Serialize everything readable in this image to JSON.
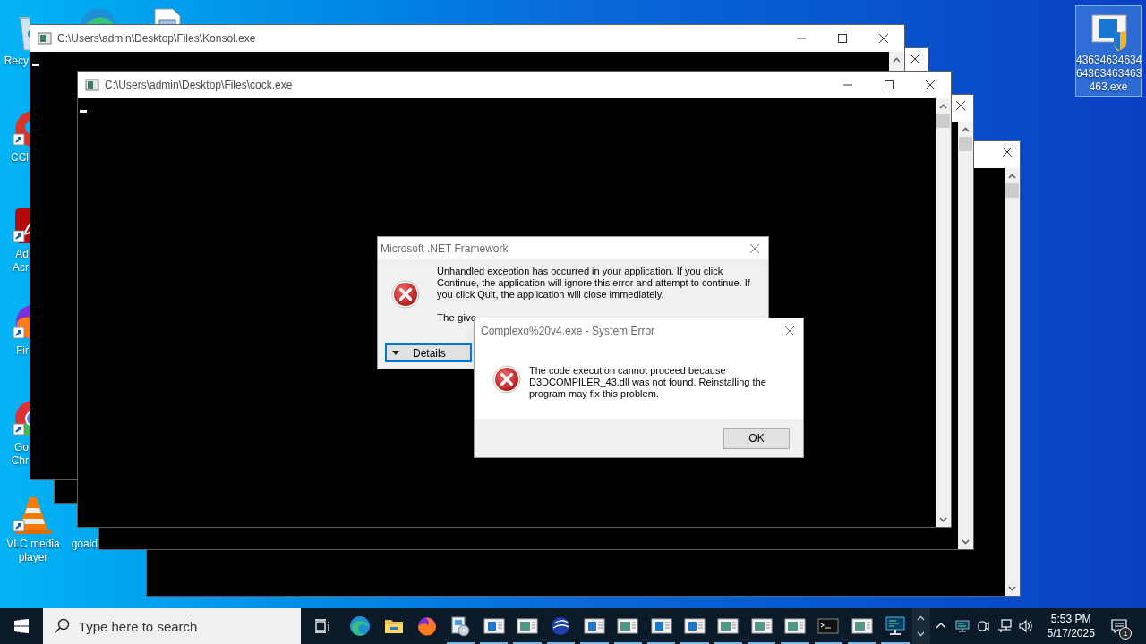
{
  "desktop": {
    "icons": [
      {
        "kind": "bin",
        "label": "Recy",
        "selected": false
      },
      {
        "kind": "edge",
        "selected": false
      },
      {
        "kind": "document",
        "selected": false
      },
      {
        "kind": "cleaner",
        "label": "CCl",
        "shortcut": true,
        "selected": false
      },
      {
        "kind": "pdf",
        "label": "Ad\nAcr",
        "shortcut": true,
        "selected": false
      },
      {
        "kind": "firefox",
        "label": "Fir",
        "shortcut": true,
        "selected": false
      },
      {
        "kind": "chrome",
        "label": "Go\nChr",
        "shortcut": true,
        "selected": false
      },
      {
        "kind": "vlc",
        "label": "VLC media\nplayer",
        "shortcut": true,
        "selected": false
      },
      {
        "kind": "blank",
        "label": "goald",
        "selected": false
      },
      {
        "kind": "installer",
        "label": "43634634634\n64363463463\n463.exe",
        "selected": true
      }
    ]
  },
  "console_windows": [
    {
      "kind": "untitled",
      "scrollbar": true
    },
    {
      "kind": "untitled",
      "scrollbar": true
    },
    {
      "kind": "untitled"
    },
    {
      "kind": "titled",
      "title": "C:\\Users\\admin\\Desktop\\Files\\Konsol.exe",
      "scrollbar": true,
      "cursor": true
    },
    {
      "kind": "titled",
      "title": "C:\\Users\\admin\\Desktop\\Files\\cock.exe",
      "scrollbar": true,
      "cursor": true
    }
  ],
  "net_dialog": {
    "title": "Microsoft .NET Framework",
    "message": "Unhandled exception has occurred in your application. If you click Continue, the application will ignore this error and attempt to continue. If you click Quit, the application will close immediately.",
    "detail": "The give",
    "details_button": "Details"
  },
  "system_error": {
    "title": "Complexo%20v4.exe - System Error",
    "message": "The code execution cannot proceed because D3DCOMPILER_43.dll was not found. Reinstalling the program may fix this problem.",
    "ok_button": "OK"
  },
  "taskbar": {
    "search": {
      "placeholder": "Type here to search"
    },
    "apps": [
      {
        "kind": "edge",
        "running": false
      },
      {
        "kind": "folder",
        "running": false
      },
      {
        "kind": "firefox",
        "running": false
      },
      {
        "kind": "installer",
        "running": true
      },
      {
        "kind": "window",
        "running": true
      },
      {
        "kind": "form",
        "running": true
      },
      {
        "kind": "badge",
        "running": true
      },
      {
        "kind": "window",
        "running": true
      },
      {
        "kind": "form",
        "running": true
      },
      {
        "kind": "window",
        "running": true
      },
      {
        "kind": "window",
        "running": true
      },
      {
        "kind": "form",
        "running": true
      },
      {
        "kind": "form",
        "running": true
      },
      {
        "kind": "form",
        "running": true
      },
      {
        "kind": "terminal",
        "running": true
      },
      {
        "kind": "form",
        "running": true
      },
      {
        "kind": "monitor",
        "running": true
      }
    ],
    "tray": [
      {
        "kind": "chevron"
      },
      {
        "kind": "monitor"
      },
      {
        "kind": "camera"
      },
      {
        "kind": "network"
      },
      {
        "kind": "volume"
      }
    ],
    "clock": {
      "time": "5:53 PM",
      "date": "5/17/2025"
    },
    "notifications": "1"
  }
}
